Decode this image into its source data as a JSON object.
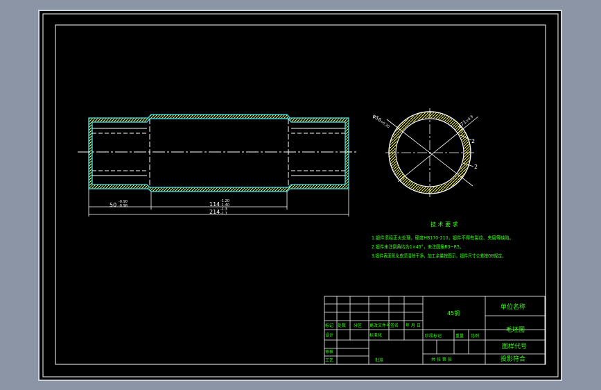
{
  "colors": {
    "background": "#8b95a6",
    "sheet": "#000000",
    "frame": "#ffffff",
    "outline": "#35c8cf",
    "hatch": "#ffff40",
    "text_green": "#39ff14",
    "dim_text": "#ffffff"
  },
  "dimensions": {
    "d50": "50",
    "d50_tol_upper": "-0.90",
    "d50_tol_lower": "-0.98",
    "d114": "114",
    "d114_tol_upper": "-1.20",
    "d114_tol_lower": "-1.40",
    "d214": "214",
    "d214_tol_upper": "-1.3",
    "d214_tol_lower": "-1.7",
    "dia_left": "φ56",
    "dia_left_tol": "+0.30",
    "dia_right": "φ71",
    "dia_right_tol": "±0.9",
    "leader_1": "2",
    "leader_2": "2"
  },
  "notes": {
    "title": "技 术 要 求",
    "line1": "1.锻件须经正火处理，硬度HB170-210，锻件不得有裂纹、夹层等缺陷。",
    "line2": "2.锻件未注倒角均为1×45°，未注圆角R3~R5。",
    "line3": "3.锻件表面氧化皮须清除干净，加工余量按图示，锻件尺寸公差按GB规定。"
  },
  "title_block": {
    "material": "45钢",
    "company": "单位名称",
    "drawing_name": "毛坯图",
    "drawing_no": "图样代号",
    "projection": "投影符合",
    "mark": "标记",
    "count": "处数",
    "zone": "分区",
    "change_doc": "更改文件号",
    "sign": "签名",
    "date": "年 月 日",
    "design": "设计",
    "standardize": "标准化",
    "review": "审核",
    "process": "工艺",
    "approve": "批准",
    "stage_mark": "阶段标记",
    "weight": "重量",
    "scale": "比例",
    "sheets": "共 张 第 张"
  }
}
